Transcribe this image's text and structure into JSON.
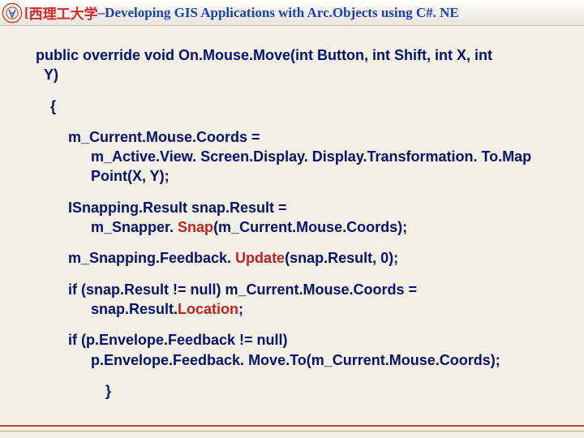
{
  "header": {
    "inst_prefix": "[",
    "inst": "西理工大学",
    "sep": " – ",
    "title": "Developing GIS Applications with Arc.Objects using C#. NE"
  },
  "code": {
    "sig1": "public override void On.Mouse.Move(int Button, int Shift, int X, int",
    "sig2": "Y)",
    "brace_open": "{",
    "l1a": "m_Current.Mouse.Coords =",
    "l1b": "m_Active.View. Screen.Display. Display.Transformation. To.Map",
    "l1c": "Point(X, Y);",
    "l2a_pre": "ISnapping.Result snap.Result =",
    "l2b_pre": "m_Snapper. ",
    "l2b_call": "Snap",
    "l2b_post": "(m_Current.Mouse.Coords);",
    "l3_pre": "m_Snapping.Feedback. ",
    "l3_call": "Update",
    "l3_post": "(snap.Result, 0);",
    "l4a": "if (snap.Result != null) m_Current.Mouse.Coords =",
    "l4b_pre": "snap.Result.",
    "l4b_call": "Location",
    "l4b_post": ";",
    "l5a": "if (p.Envelope.Feedback != null)",
    "l5b": "p.Envelope.Feedback. Move.To(m_Current.Mouse.Coords);",
    "brace_close": "}"
  }
}
